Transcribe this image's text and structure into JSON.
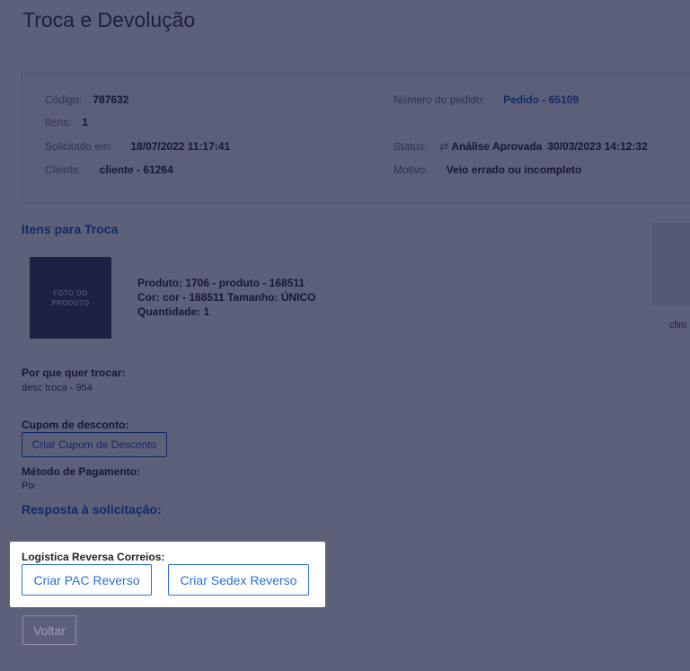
{
  "page": {
    "title": "Troca e Devolução"
  },
  "info": {
    "codigo_label": "Código:",
    "codigo_value": "787632",
    "itens_label": "Itens:",
    "itens_value": "1",
    "solicitado_label": "Solicitado em:",
    "solicitado_value": "18/07/2022 11:17:41",
    "cliente_label": "Cliente:",
    "cliente_value": "cliente - 61264",
    "pedido_label": "Número do pedido:",
    "pedido_value": "Pedido - 65109",
    "status_label": "Status:",
    "status_icon": "⇄",
    "status_value": "Análise Aprovada",
    "status_date": "30/03/2023 14:12:32",
    "motivo_label": "Motivo:",
    "motivo_value": "Veio errado ou incompleto"
  },
  "items_section": {
    "title": "Itens para Troca",
    "photo_placeholder_line1": "FOTO DO",
    "photo_placeholder_line2": "PRODUTO",
    "produto": "Produto: 1706 - produto - 168511",
    "cor_tamanho": "Cor: cor - 168511 Tamanho: ÚNICO",
    "quantidade": "Quantidade: 1",
    "side_text": "clim"
  },
  "reason": {
    "label": "Por que quer trocar:",
    "value": "desc troca - 954"
  },
  "coupon": {
    "label": "Cupom de desconto:",
    "button": "Criar Cupom de Desconto"
  },
  "payment": {
    "label": "Método de Pagamento:",
    "value": "Pix"
  },
  "response": {
    "title": "Resposta à solicitação:"
  },
  "logistics": {
    "label": "Logistica Reversa Correios:",
    "pac_button": "Criar PAC Reverso",
    "sedex_button": "Criar Sedex Reverso"
  },
  "footer": {
    "back_button": "Voltar"
  }
}
